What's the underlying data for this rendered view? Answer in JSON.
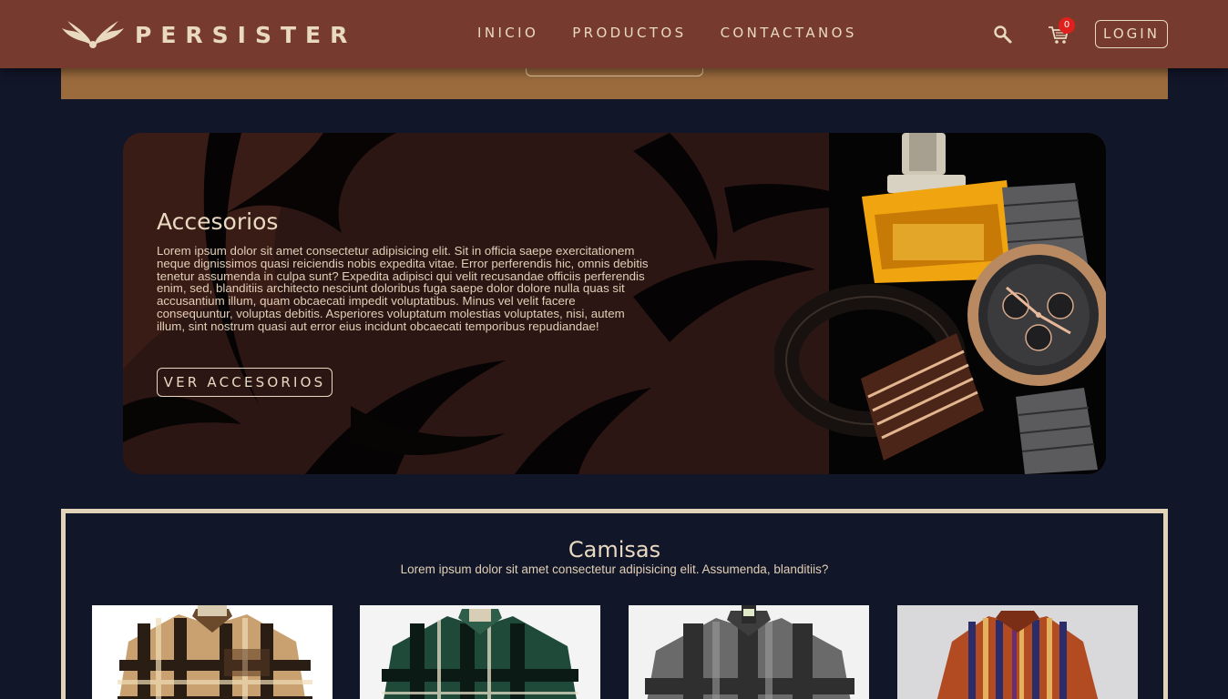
{
  "header": {
    "brand": "PERSISTER",
    "nav": [
      "INICIO",
      "PRODUCTOS",
      "CONTACTANOS"
    ],
    "cart_count": "0",
    "login_label": "LOGIN",
    "icons": [
      "wings-logo-icon",
      "search-icon",
      "cart-icon"
    ]
  },
  "banner": {
    "title": "Accesorios",
    "text": "Lorem ipsum dolor sit amet consectetur adipisicing elit. Sit in officia saepe exercitationem neque dignissimos quasi reiciendis nobis expedita vitae. Error perferendis hic, omnis debitis tenetur assumenda in culpa sunt? Expedita adipisci qui velit recusandae officiis perferendis enim, sed, blanditiis architecto nesciunt doloribus fuga saepe dolor dolore nulla quas sit accusantium illum, quam obcaecati impedit voluptatibus. Minus vel velit facere consequuntur, voluptas debitis. Asperiores voluptatum molestias voluptates, nisi, autem illum, sint nostrum quasi aut error eius incidunt obcaecati temporibus repudiandae!",
    "button_label": "VER ACCESORIOS"
  },
  "shirts": {
    "title": "Camisas",
    "subtitle": "Lorem ipsum dolor sit amet consectetur adipisicing elit. Assumenda, blanditiis?"
  },
  "colors": {
    "header_bg": "#763a2e",
    "page_bg": "#121629",
    "accent_text": "#e9d9c1",
    "gold": "#9b6b3e",
    "badge": "#e0201c"
  }
}
